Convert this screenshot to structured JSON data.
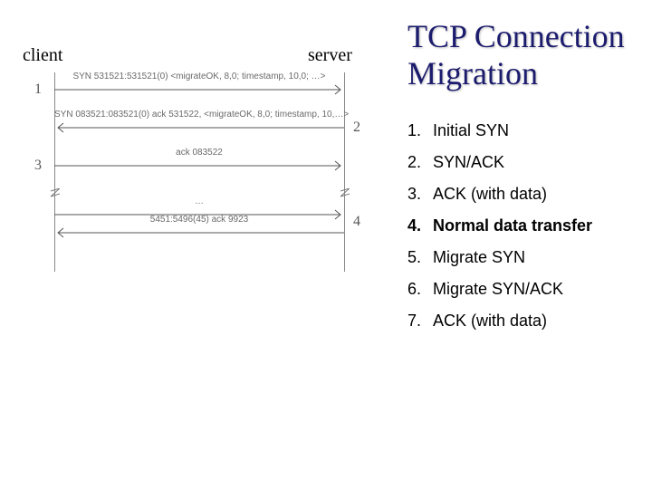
{
  "title": "TCP Connection Migration",
  "actors": {
    "client": "client",
    "server": "server"
  },
  "steps_labels": [
    "1",
    "2",
    "3",
    "4"
  ],
  "captions": {
    "c1": "SYN 531521:531521(0) <migrateOK, 8,0; timestamp, 10,0; …>",
    "c2": "SYN 083521:083521(0) ack 531522, <migrateOK, 8,0; timestamp, 10,…>",
    "c3": "ack 083522",
    "c4a": "…",
    "c4b": "5451:5496(45) ack 9923"
  },
  "bullets": [
    {
      "n": "1.",
      "t": "Initial SYN"
    },
    {
      "n": "2.",
      "t": "SYN/ACK"
    },
    {
      "n": "3.",
      "t": "ACK (with data)"
    },
    {
      "n": "4.",
      "t": "Normal data transfer"
    },
    {
      "n": "5.",
      "t": "Migrate SYN"
    },
    {
      "n": "6.",
      "t": "Migrate SYN/ACK"
    },
    {
      "n": "7.",
      "t": "ACK (with data)"
    }
  ],
  "active_bullet_index": 3
}
